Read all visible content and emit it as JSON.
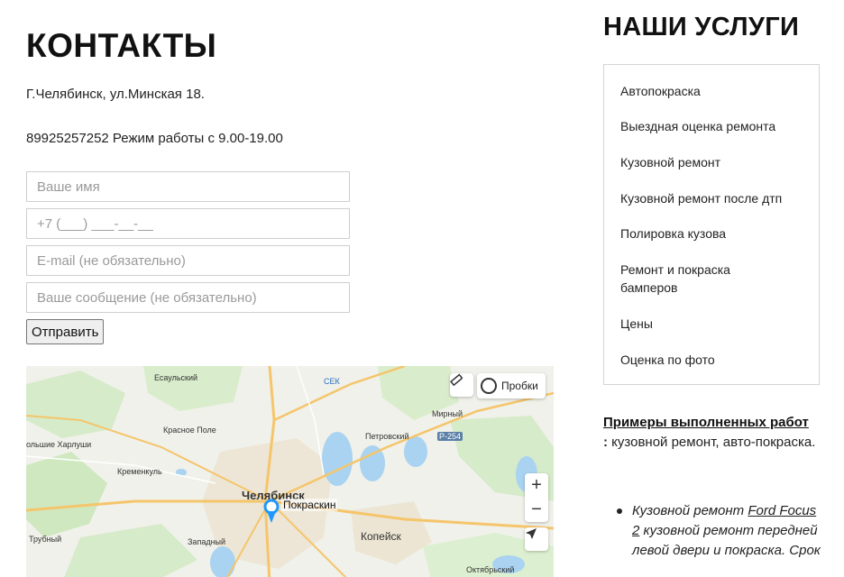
{
  "contacts": {
    "title": "КОНТАКТЫ",
    "address": "Г.Челябинск, ул.Минская 18.",
    "phone_line": "89925257252 Режим работы с 9.00-19.00"
  },
  "form": {
    "name_placeholder": "Ваше имя",
    "phone_placeholder": "+7 (___) ___-__-__",
    "email_placeholder": "E-mail (не обязательно)",
    "message_placeholder": "Ваше сообщение (не обязательно)",
    "submit_label": "Отправить"
  },
  "map": {
    "traffic_label": "Пробки",
    "pin_label": "Покраскин",
    "zoom_in": "+",
    "zoom_out": "−",
    "places": {
      "esaulsky": "Есаульский",
      "sek": "СЕК",
      "krasnoe_pole": "Красное Поле",
      "kharlushi": "ольшие Харлуши",
      "kremenkul": "Кременкуль",
      "chelyabinsk": "Челябинск",
      "trubny": "Трубный",
      "zapadny": "Западный",
      "mirny": "Мирный",
      "petrovsky": "Петровский",
      "r254": "Р-254",
      "kopeysk": "Копейск",
      "oktyabrsky": "Октябрьский"
    }
  },
  "services": {
    "title": "НАШИ УСЛУГИ",
    "items": [
      "Автопокраска",
      "Выездная оценка ремонта",
      "Кузовной ремонт",
      "Кузовной ремонт после дтп",
      "Полировка кузова",
      "Ремонт и покраска бамперов",
      "Цены",
      "Оценка по фото"
    ]
  },
  "examples": {
    "link_label": "Примеры выполненных работ",
    "colon": ":",
    "description": " кузовной ремонт, авто-покраска.",
    "item_prefix": "Кузовной ремонт ",
    "item_link": "Ford Focus 2",
    "item_suffix": " кузовной ремонт передней левой двери и покраска. Срок"
  },
  "colors": {
    "border": "#cfcfcf",
    "map_water": "#a9d3f0",
    "map_forest": "#cfe8c0",
    "map_road": "#f5c56b",
    "pin": "#1e98ff"
  }
}
